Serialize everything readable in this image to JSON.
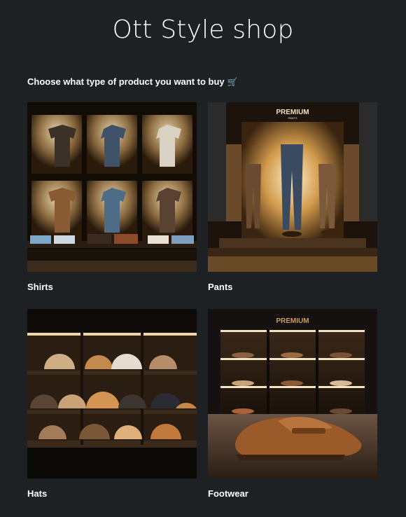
{
  "page": {
    "title": "Ott Style shop",
    "prompt": "Choose what type of product you want to buy",
    "prompt_icon": "shopping-cart-icon"
  },
  "categories": [
    {
      "label": "Shirts"
    },
    {
      "label": "Pants"
    },
    {
      "label": "Hats"
    },
    {
      "label": "Footwear"
    }
  ],
  "image_text": {
    "pants_sign": "PREMIUM",
    "pants_sign_sub": "PANTS",
    "footwear_sign": "PREMIUM"
  },
  "colors": {
    "background": "#1d2124",
    "text": "#ffffff"
  }
}
